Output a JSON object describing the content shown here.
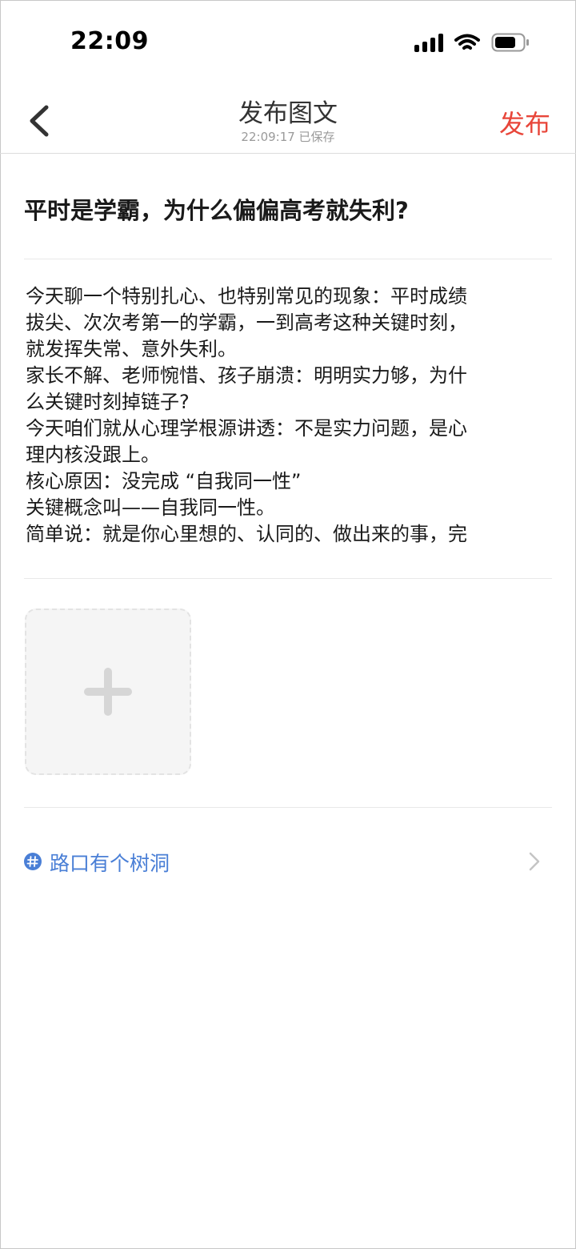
{
  "status_bar": {
    "time": "22:09"
  },
  "nav": {
    "title": "发布图文",
    "saved_status": "22:09:17 已保存",
    "publish_label": "发布"
  },
  "post": {
    "title": "平时是学霸，为什么偏偏高考就失利?",
    "body_lines": [
      "今天聊一个特别扎心、也特别常见的现象：平时成绩",
      "拔尖、次次考第一的学霸，一到高考这种关键时刻，",
      "就发挥失常、意外失利。",
      "家长不解、老师惋惜、孩子崩溃：明明实力够，为什",
      "么关键时刻掉链子?",
      "今天咱们就从心理学根源讲透：不是实力问题，是心",
      "理内核没跟上。",
      "核心原因：没完成 “自我同一性”",
      "关键概念叫——自我同一性。",
      "简单说：就是你心里想的、认同的、做出来的事，完"
    ]
  },
  "topic": {
    "label": "路口有个树洞",
    "icon": "hashtag-icon"
  },
  "colors": {
    "accent_red": "#e8463a",
    "topic_blue": "#4a7fd6"
  }
}
